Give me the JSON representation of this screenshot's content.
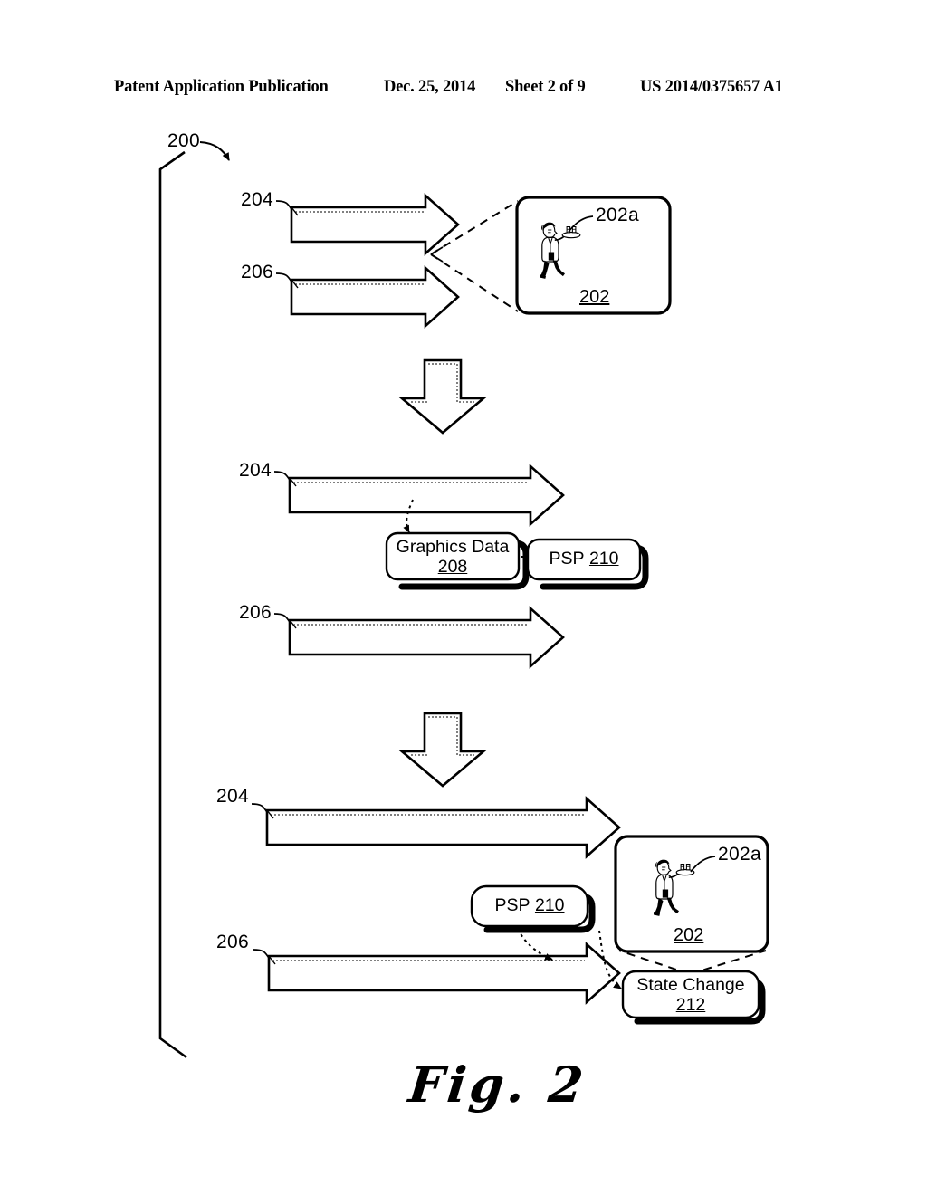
{
  "header": {
    "title": "Patent Application Publication",
    "date": "Dec. 25, 2014",
    "sheet": "Sheet 2 of 9",
    "number": "US 2014/0375657 A1"
  },
  "figure": {
    "caption": "Fig. 2",
    "system_ref": "200",
    "stages": [
      {
        "name": "stage-1-transmission",
        "refs": [
          "204",
          "206"
        ],
        "screen": {
          "ref": "202",
          "element_ref": "202a",
          "content": "running waiter carrying tray with two glasses"
        }
      },
      {
        "name": "stage-2-graphics-data",
        "refs": [
          "204",
          "206"
        ],
        "boxes": [
          {
            "label": "Graphics Data",
            "ref": "208"
          },
          {
            "label": "PSP",
            "ref": "210"
          }
        ]
      },
      {
        "name": "stage-3-state-change",
        "refs": [
          "204",
          "206"
        ],
        "boxes": [
          {
            "label": "PSP",
            "ref": "210"
          },
          {
            "label": "State Change",
            "ref": "212"
          }
        ],
        "screen": {
          "ref": "202",
          "element_ref": "202a",
          "content": "running waiter carrying tray with two glasses"
        }
      }
    ]
  },
  "labels": {
    "ref_200": "200",
    "ref_204_a": "204",
    "ref_206_a": "206",
    "ref_202a_top": "202a",
    "ref_202_top": "202",
    "ref_204_b": "204",
    "ref_206_b": "206",
    "graphics_data_title": "Graphics Data",
    "graphics_data_ref": "208",
    "psp_mid_title": "PSP",
    "psp_mid_ref": "210",
    "ref_204_c": "204",
    "ref_206_c": "206",
    "psp_bot_title": "PSP",
    "psp_bot_ref": "210",
    "state_change_title": "State Change",
    "state_change_ref": "212",
    "ref_202a_bot": "202a",
    "ref_202_bot": "202",
    "fig_caption": "Fig. 2"
  },
  "colors": {
    "ink": "#000000",
    "paper": "#ffffff"
  }
}
